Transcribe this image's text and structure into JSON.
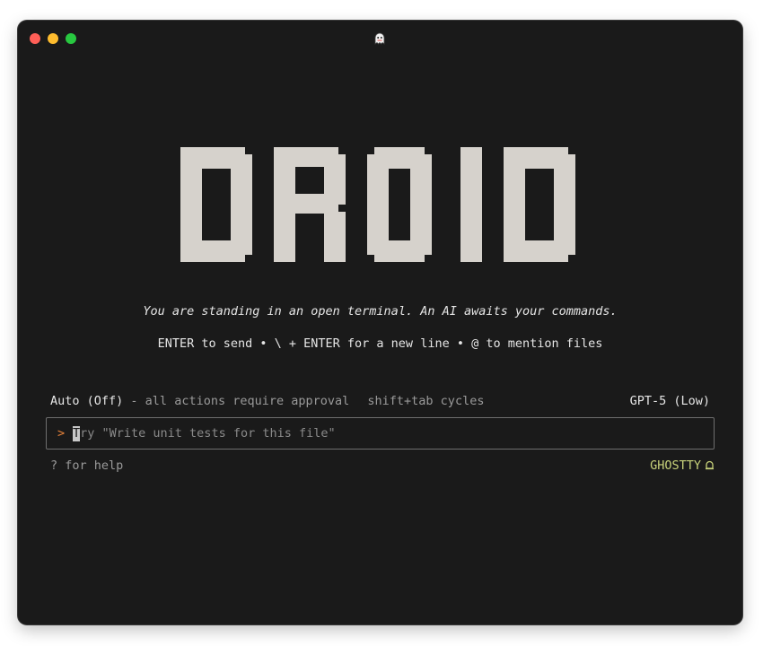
{
  "window": {
    "title_icon": "ghost-icon"
  },
  "banner": {
    "text": "DROID",
    "color": "#d6d2cc"
  },
  "tagline": "You are standing in an open terminal. An AI awaits your commands.",
  "hints": "ENTER to send • \\ + ENTER for a new line • @ to mention files",
  "status": {
    "mode": "Auto (Off)",
    "mode_description": "- all actions require approval",
    "cycle_hint": "shift+tab cycles",
    "model": "GPT-5 (Low)"
  },
  "input": {
    "prompt": ">",
    "placeholder_first_char": "T",
    "placeholder_rest": "ry \"Write unit tests for this file\""
  },
  "footer": {
    "help": "? for help",
    "terminal_name": "GHOSTTY",
    "terminal_icon": "bell-icon"
  },
  "colors": {
    "background": "#1a1a1a",
    "accent_orange": "#e8833a",
    "terminal_name": "#c8d27a"
  }
}
